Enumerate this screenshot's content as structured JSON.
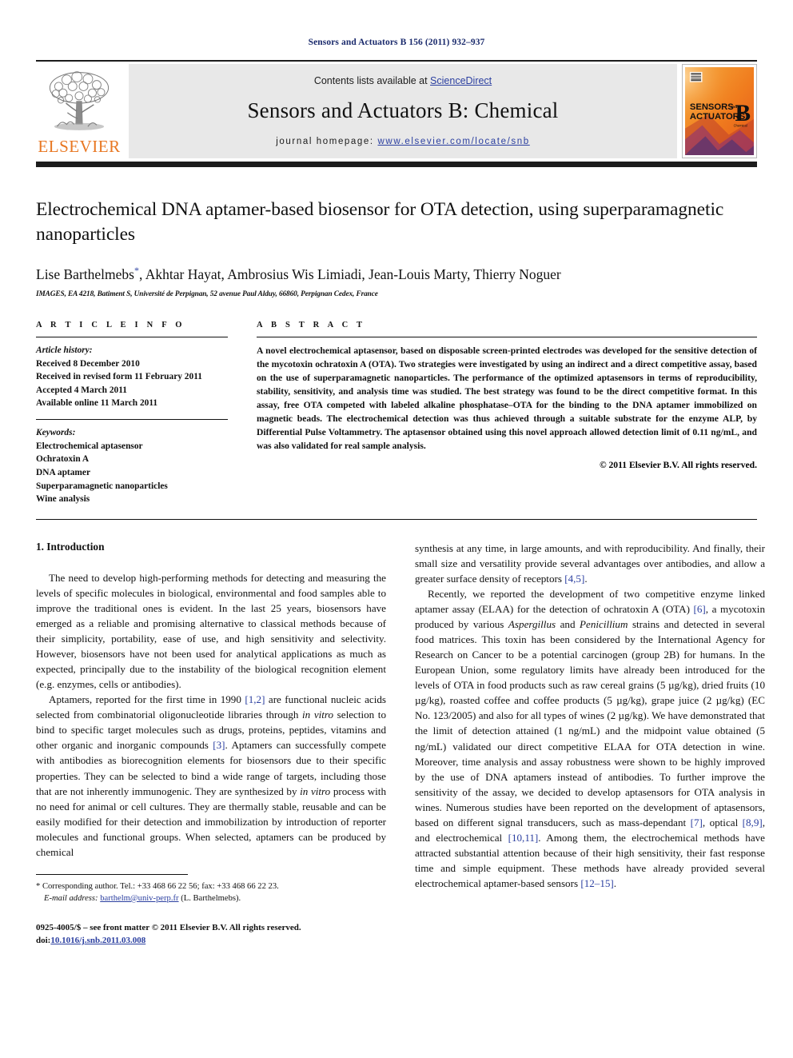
{
  "running_head": "Sensors and Actuators B 156 (2011) 932–937",
  "masthead": {
    "contents_prefix": "Contents lists available at ",
    "sciencedirect": "ScienceDirect",
    "journal_title": "Sensors and Actuators B: Chemical",
    "homepage_prefix": "journal homepage:",
    "homepage_url": "www.elsevier.com/locate/snb",
    "publisher": "ELSEVIER",
    "cover": {
      "line1": "SENSORS",
      "and": "and",
      "line2": "ACTUATORS",
      "letter": "B",
      "sub": "Chemical"
    },
    "colors": {
      "link": "#2b3fa0",
      "elsevier_orange": "#E87722",
      "banner_bg": "#e8e8e8",
      "rule": "#1c1c1c"
    }
  },
  "article": {
    "title": "Electrochemical DNA aptamer-based biosensor for OTA detection, using superparamagnetic nanoparticles",
    "authors_pre": "Lise Barthelmebs",
    "authors_star": "*",
    "authors_post": ", Akhtar Hayat, Ambrosius Wis Limiadi, Jean-Louis Marty, Thierry Noguer",
    "affiliation": "IMAGES, EA 4218, Batiment S, Université de Perpignan, 52 avenue Paul Alduy, 66860, Perpignan Cedex, France"
  },
  "info": {
    "heading": "A R T I C L E  I N F O",
    "history_label": "Article history:",
    "history": [
      "Received 8 December 2010",
      "Received in revised form 11 February 2011",
      "Accepted 4 March 2011",
      "Available online 11 March 2011"
    ],
    "keywords_label": "Keywords:",
    "keywords": [
      "Electrochemical aptasensor",
      "Ochratoxin A",
      "DNA aptamer",
      "Superparamagnetic nanoparticles",
      "Wine analysis"
    ]
  },
  "abstract": {
    "heading": "A B S T R A C T",
    "text": "A novel electrochemical aptasensor, based on disposable screen-printed electrodes was developed for the sensitive detection of the mycotoxin ochratoxin A (OTA). Two strategies were investigated by using an indirect and a direct competitive assay, based on the use of superparamagnetic nanoparticles. The performance of the optimized aptasensors in terms of reproducibility, stability, sensitivity, and analysis time was studied. The best strategy was found to be the direct competitive format. In this assay, free OTA competed with labeled alkaline phosphatase–OTA for the binding to the DNA aptamer immobilized on magnetic beads. The electrochemical detection was thus achieved through a suitable substrate for the enzyme ALP, by Differential Pulse Voltammetry. The aptasensor obtained using this novel approach allowed detection limit of 0.11 ng/mL, and was also validated for real sample analysis.",
    "copyright": "© 2011 Elsevier B.V. All rights reserved."
  },
  "body": {
    "section_heading": "1. Introduction",
    "left": {
      "p1": "The need to develop high-performing methods for detecting and measuring the levels of specific molecules in biological, environmental and food samples able to improve the traditional ones is evident. In the last 25 years, biosensors have emerged as a reliable and promising alternative to classical methods because of their simplicity, portability, ease of use, and high sensitivity and selectivity. However, biosensors have not been used for analytical applications as much as expected, principally due to the instability of the biological recognition element (e.g. enzymes, cells or antibodies).",
      "p2_a": "Aptamers, reported for the first time in 1990 ",
      "p2_cite1": "[1,2]",
      "p2_b": " are functional nucleic acids selected from combinatorial oligonucleotide libraries through ",
      "p2_it1": "in vitro",
      "p2_c": " selection to bind to specific target molecules such as drugs, proteins, peptides, vitamins and other organic and inorganic compounds ",
      "p2_cite2": "[3]",
      "p2_d": ". Aptamers can successfully compete with antibodies as biorecognition elements for biosensors due to their specific properties. They can be selected to bind a wide range of targets, including those that are not inherently immunogenic. They are synthesized by ",
      "p2_it2": "in vitro",
      "p2_e": " process with no need for animal or cell cultures. They are thermally stable, reusable and can be easily modified for their detection and immobilization by introduction of reporter molecules and functional groups. When selected, aptamers can be produced by chemical"
    },
    "right": {
      "p1_a": "synthesis at any time, in large amounts, and with reproducibility. And finally, their small size and versatility provide several advantages over antibodies, and allow a greater surface density of receptors ",
      "p1_cite": "[4,5]",
      "p1_b": ".",
      "p2_a": "Recently, we reported the development of two competitive enzyme linked aptamer assay (ELAA) for the detection of ochratoxin A (OTA) ",
      "p2_cite1": "[6]",
      "p2_b": ", a mycotoxin produced by various ",
      "p2_it1": "Aspergillus",
      "p2_c": " and ",
      "p2_it2": "Penicillium",
      "p2_d": " strains and detected in several food matrices. This toxin has been considered by the International Agency for Research on Cancer to be a potential carcinogen (group 2B) for humans. In the European Union, some regulatory limits have already been introduced for the levels of OTA in food products such as raw cereal grains (5 µg/kg), dried fruits (10 µg/kg), roasted coffee and coffee products (5 µg/kg), grape juice (2 µg/kg) (EC No. 123/2005) and also for all types of wines (2 µg/kg). We have demonstrated that the limit of detection attained (1 ng/mL) and the midpoint value obtained (5 ng/mL) validated our direct competitive ELAA for OTA detection in wine. Moreover, time analysis and assay robustness were shown to be highly improved by the use of DNA aptamers instead of antibodies. To further improve the sensitivity of the assay, we decided to develop aptasensors for OTA analysis in wines. Numerous studies have been reported on the development of aptasensors, based on different signal transducers, such as mass-dependant ",
      "p2_cite2": "[7]",
      "p2_e": ", optical ",
      "p2_cite3": "[8,9]",
      "p2_f": ", and electrochemical ",
      "p2_cite4": "[10,11]",
      "p2_g": ". Among them, the electrochemical methods have attracted substantial attention because of their high sensitivity, their fast response time and simple equipment. These methods have already provided several electrochemical aptamer-based sensors ",
      "p2_cite5": "[12–15]",
      "p2_h": "."
    }
  },
  "footnote": {
    "corresponding": "* Corresponding author. Tel.: +33 468 66 22 56; fax: +33 468 66 22 23.",
    "email_label": "E-mail address:",
    "email": "barthelm@univ-perp.fr",
    "email_suffix": " (L. Barthelmebs).",
    "issn_line": "0925-4005/$ – see front matter © 2011 Elsevier B.V. All rights reserved.",
    "doi_label": "doi:",
    "doi": "10.1016/j.snb.2011.03.008"
  }
}
